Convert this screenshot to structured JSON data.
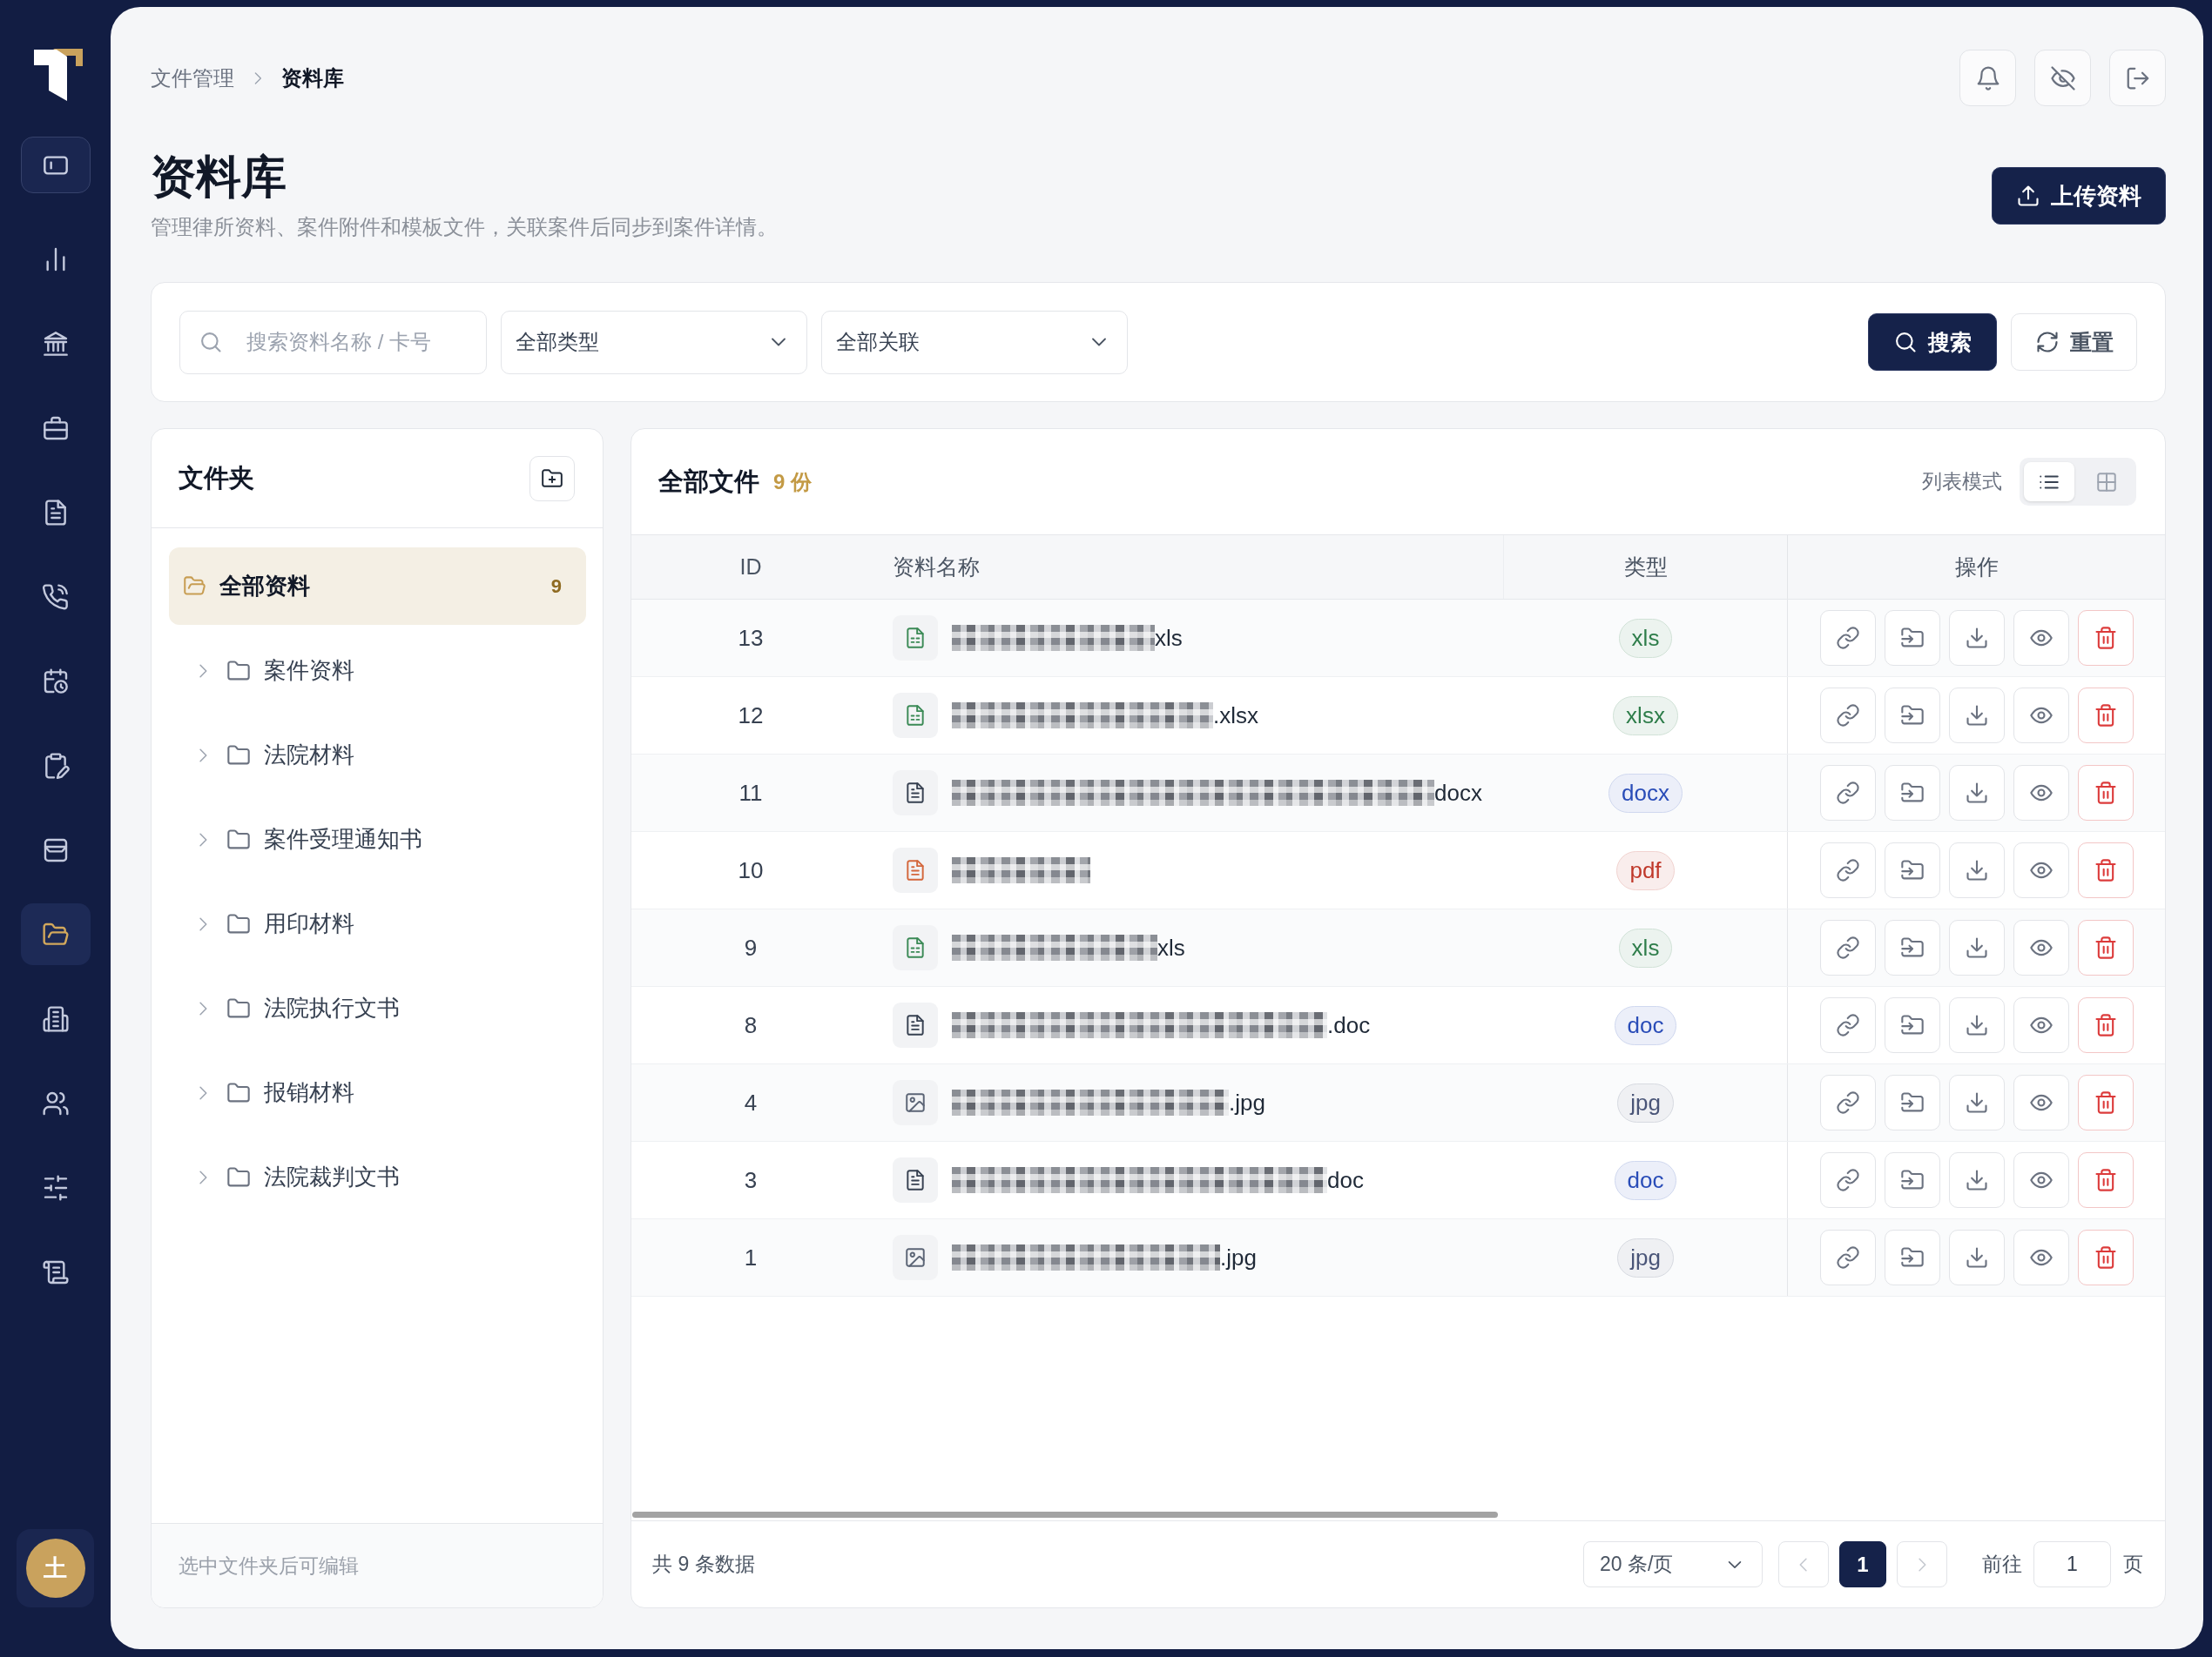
{
  "sidebar": {
    "items": [
      {
        "selected": false
      },
      {
        "selected": false
      },
      {
        "selected": false
      },
      {
        "selected": false
      },
      {
        "selected": false
      },
      {
        "selected": false
      },
      {
        "selected": false
      },
      {
        "selected": false
      },
      {
        "selected": true
      },
      {
        "selected": false
      },
      {
        "selected": false
      },
      {
        "selected": false
      },
      {
        "selected": false
      }
    ],
    "avatar": {
      "initial": "土"
    }
  },
  "breadcrumb": [
    {
      "label": "文件管理",
      "current": false
    },
    {
      "label": "资料库",
      "current": true
    }
  ],
  "page": {
    "title": "资料库",
    "subtitle": "管理律所资料、案件附件和模板文件，关联案件后同步到案件详情。",
    "upload_button": "上传资料"
  },
  "filters": {
    "search": {
      "placeholder": "搜索资料名称 / 卡号"
    },
    "selects": [
      {
        "value": "全部类型"
      },
      {
        "value": "全部关联"
      }
    ],
    "search_button": "搜索",
    "reset_button": "重置"
  },
  "folders": {
    "title": "文件夹",
    "all": {
      "label": "全部资料",
      "count": "9",
      "selected": true
    },
    "items": [
      {
        "label": "案件资料",
        "selected": false,
        "expanded": false
      },
      {
        "label": "法院材料",
        "selected": false,
        "expanded": false
      },
      {
        "label": "案件受理通知书",
        "selected": false,
        "expanded": false
      },
      {
        "label": "用印材料",
        "selected": false,
        "expanded": false
      },
      {
        "label": "法院执行文书",
        "selected": false,
        "expanded": false
      },
      {
        "label": "报销材料",
        "selected": false,
        "expanded": false
      },
      {
        "label": "法院裁判文书",
        "selected": false,
        "expanded": false
      }
    ],
    "footer": "选中文件夹后可编辑"
  },
  "files": {
    "title": "全部文件",
    "count": "9 份",
    "view_label": "列表模式",
    "views": [
      {
        "kind": "list",
        "selected": true
      },
      {
        "kind": "grid",
        "selected": false
      }
    ],
    "table": {
      "columns": [
        "ID",
        "资料名称",
        "类型",
        "操作"
      ],
      "rows": [
        {
          "id": "13",
          "kind": "spreadsheet",
          "masked": true,
          "name": "xls",
          "type": "xls",
          "color": "#2e7d4a"
        },
        {
          "id": "12",
          "kind": "spreadsheet",
          "masked": true,
          "name": ".xlsx",
          "type": "xlsx",
          "color": "#2e7d4a"
        },
        {
          "id": "11",
          "kind": "document",
          "masked": true,
          "name": "docx",
          "type": "docx",
          "color": "#2a4db8"
        },
        {
          "id": "10",
          "kind": "pdf",
          "masked": true,
          "type": "pdf",
          "color": "#c0392b"
        },
        {
          "id": "9",
          "kind": "spreadsheet",
          "masked": true,
          "name": "xls",
          "type": "xls",
          "color": "#2e7d4a"
        },
        {
          "id": "8",
          "kind": "document",
          "masked": true,
          "name": ".doc",
          "type": "doc",
          "color": "#2a4db8"
        },
        {
          "id": "4",
          "kind": "image",
          "masked": true,
          "name": ".jpg",
          "type": "jpg",
          "color": "#4a5578"
        },
        {
          "id": "3",
          "kind": "document",
          "masked": true,
          "name": "doc",
          "type": "doc",
          "color": "#2a4db8"
        },
        {
          "id": "1",
          "kind": "image",
          "masked": true,
          "name": ".jpg",
          "type": "jpg",
          "color": "#4a5578"
        }
      ]
    },
    "pagination": {
      "total": "共 9 条数据",
      "page_size": "20 条/页",
      "prev": {
        "disabled": true
      },
      "pages": [
        {
          "label": "1",
          "selected": true
        }
      ],
      "next": {
        "disabled": true
      },
      "goto_label": "前往",
      "goto_value": "1",
      "goto_suffix": "页"
    }
  }
}
